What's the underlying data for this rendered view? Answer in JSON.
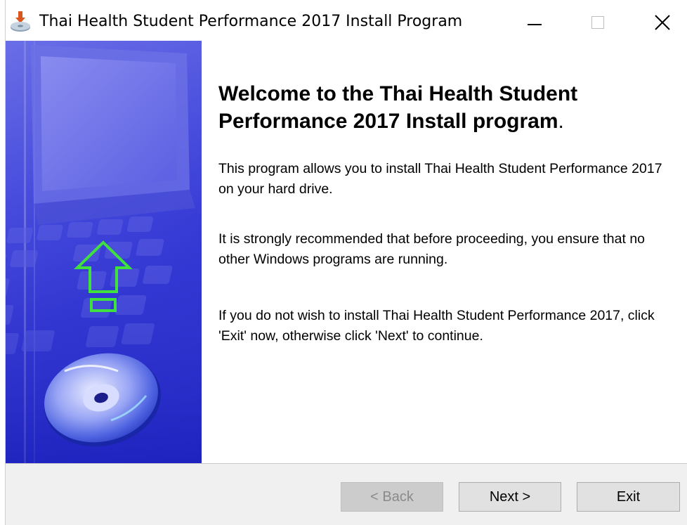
{
  "window": {
    "title": "Thai Health Student Performance 2017 Install Program",
    "controls": {
      "minimize": "minimize-icon",
      "maximize": "maximize-icon",
      "close": "close-icon"
    }
  },
  "content": {
    "heading": "Welcome to the Thai Health Student Performance 2017 Install program",
    "heading_dot": ".",
    "paragraphs": [
      "This program allows you to install Thai Health Student Performance 2017 on your hard drive.",
      "It is strongly recommended that before proceeding, you ensure that no other Windows programs are running.",
      "If you do not wish to install Thai Health Student Performance 2017, click 'Exit' now, otherwise click 'Next' to continue."
    ]
  },
  "buttons": {
    "back": {
      "label": "< Back",
      "enabled": false
    },
    "next": {
      "label": "Next >",
      "enabled": true
    },
    "exit": {
      "label": "Exit",
      "enabled": true
    }
  },
  "colors": {
    "banner_blue": "#2f33d2",
    "arrow_green": "#33dd33",
    "button_face": "#e1e1e1",
    "panel_gray": "#f0f0f0"
  }
}
